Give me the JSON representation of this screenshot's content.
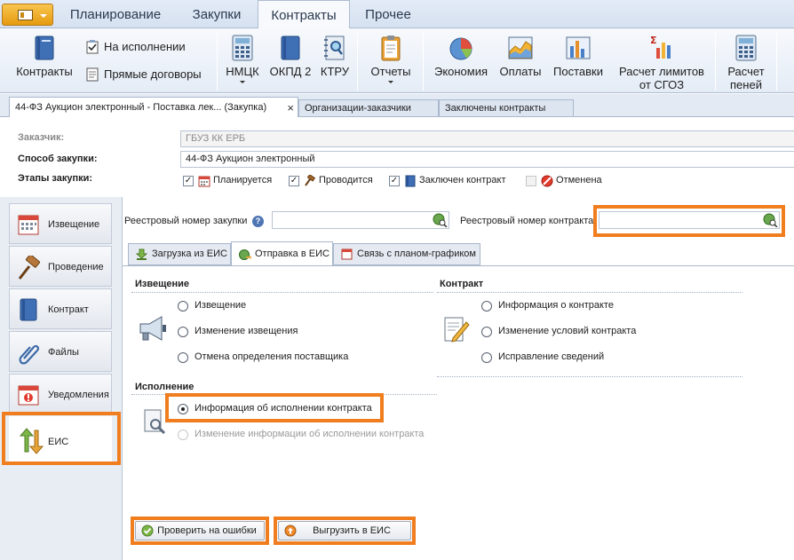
{
  "ribbon_tabs": [
    {
      "label": "Планирование"
    },
    {
      "label": "Закупки"
    },
    {
      "label": "Контракты",
      "active": true
    },
    {
      "label": "Прочее"
    }
  ],
  "ribbon": {
    "contracts_label": "Контракты",
    "in_execution_label": "На исполнении",
    "direct_contracts_label": "Прямые договоры",
    "nmck_label": "НМЦК",
    "okpd_label": "ОКПД 2",
    "ktru_label": "КТРУ",
    "reports_label": "Отчеты",
    "economy_label": "Экономия",
    "payments_label": "Оплаты",
    "deliveries_label": "Поставки",
    "limits_label_1": "Расчет лимитов",
    "limits_label_2": "от СГОЗ",
    "penalty_label_1": "Расчет",
    "penalty_label_2": "пеней"
  },
  "doc_tabs": [
    {
      "label": "44-ФЗ Аукцион электронный - Поставка лек... (Закупка)",
      "close": "×",
      "active": true
    },
    {
      "label": "Организации-заказчики"
    },
    {
      "label": "Заключены контракты"
    }
  ],
  "header": {
    "customer_label": "Заказчик:",
    "customer_value": "ГБУЗ КК ЕРБ",
    "method_label": "Способ закупки:",
    "method_value": "44-ФЗ Аукцион электронный",
    "stages_label": "Этапы закупки:",
    "stages": [
      {
        "label": "Планируется",
        "checked": true
      },
      {
        "label": "Проводится",
        "checked": true
      },
      {
        "label": "Заключен контракт",
        "checked": true
      },
      {
        "label": "Отменена",
        "checked": false
      }
    ],
    "check_mark": "✓"
  },
  "left_nav": [
    {
      "label": "Извещение"
    },
    {
      "label": "Проведение"
    },
    {
      "label": "Контракт"
    },
    {
      "label": "Файлы"
    },
    {
      "label": "Уведомления"
    },
    {
      "label": "ЕИС",
      "active": true
    }
  ],
  "registry": {
    "purchase_label": "Реестровый номер закупки",
    "purchase_value": "",
    "help": "?",
    "contract_label": "Реестровый номер контракта",
    "contract_value": ""
  },
  "inner_tabs": [
    {
      "label": "Загрузка из ЕИС"
    },
    {
      "label": "Отправка в ЕИС",
      "active": true
    },
    {
      "label": "Связь с планом-графиком"
    }
  ],
  "sections": {
    "notice": {
      "title": "Извещение",
      "options": [
        "Извещение",
        "Изменение извещения",
        "Отмена определения поставщика"
      ]
    },
    "contract": {
      "title": "Контракт",
      "options": [
        "Информация о контракте",
        "Изменение условий контракта",
        "Исправление сведений"
      ]
    },
    "execution": {
      "title": "Исполнение",
      "options": [
        "Информация об исполнении контракта",
        "Изменение информации об исполнении контракта"
      ]
    }
  },
  "buttons": {
    "check_label": "Проверить на ошибки",
    "upload_label": "Выгрузить в ЕИС"
  },
  "colors": {
    "highlight": "#f07d1e",
    "ribbon_bg": "#e4ecf6"
  }
}
